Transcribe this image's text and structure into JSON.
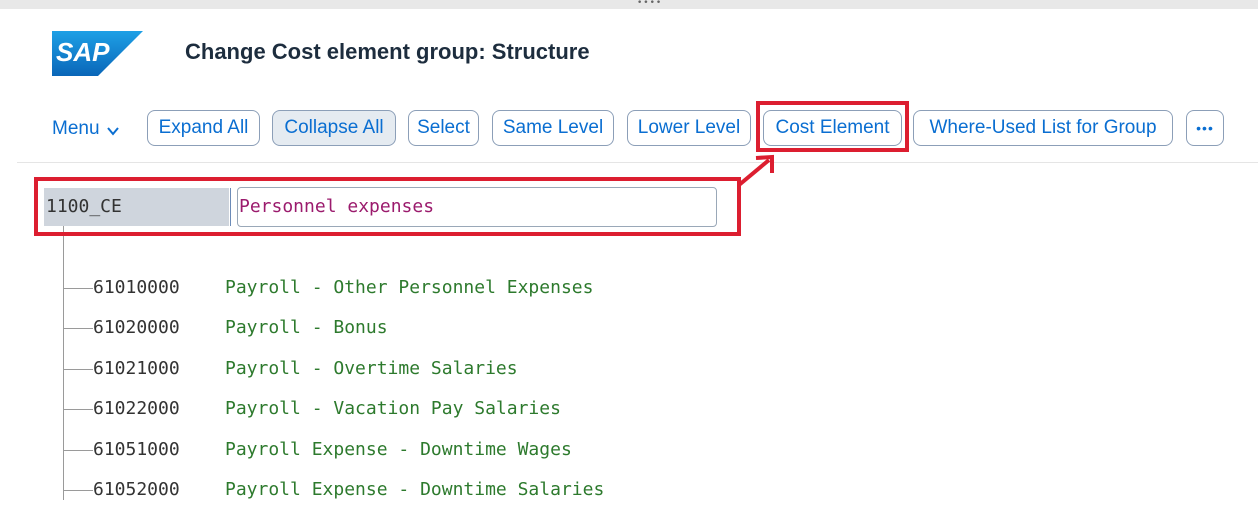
{
  "header": {
    "logo_text": "SAP",
    "title": "Change Cost element group: Structure"
  },
  "toolbar": {
    "menu_label": "Menu",
    "buttons": [
      {
        "label": "Expand All"
      },
      {
        "label": "Collapse All",
        "active": true
      },
      {
        "label": "Select"
      },
      {
        "label": "Same Level"
      },
      {
        "label": "Lower Level"
      },
      {
        "label": "Cost Element"
      },
      {
        "label": "Where-Used List for Group"
      },
      {
        "label": "•••"
      }
    ]
  },
  "group": {
    "id": "1100_CE",
    "description": "Personnel expenses"
  },
  "elements": [
    {
      "number": "61010000",
      "description": "Payroll - Other Personnel Expenses"
    },
    {
      "number": "61020000",
      "description": "Payroll - Bonus"
    },
    {
      "number": "61021000",
      "description": "Payroll - Overtime Salaries"
    },
    {
      "number": "61022000",
      "description": "Payroll - Vacation Pay Salaries"
    },
    {
      "number": "61051000",
      "description": "Payroll Expense - Downtime Wages"
    },
    {
      "number": "61052000",
      "description": "Payroll Expense - Downtime Salaries"
    }
  ],
  "icons": [
    "sap-logo",
    "chevron-down-icon",
    "more-options-icon",
    "annotation-arrow-icon"
  ],
  "colors": {
    "accent": "#0a6ed1",
    "highlight": "#dc1e30",
    "group_description": "#9b1b6d",
    "element_description": "#2d7a2d",
    "sap_blue": "#0a74c9"
  }
}
